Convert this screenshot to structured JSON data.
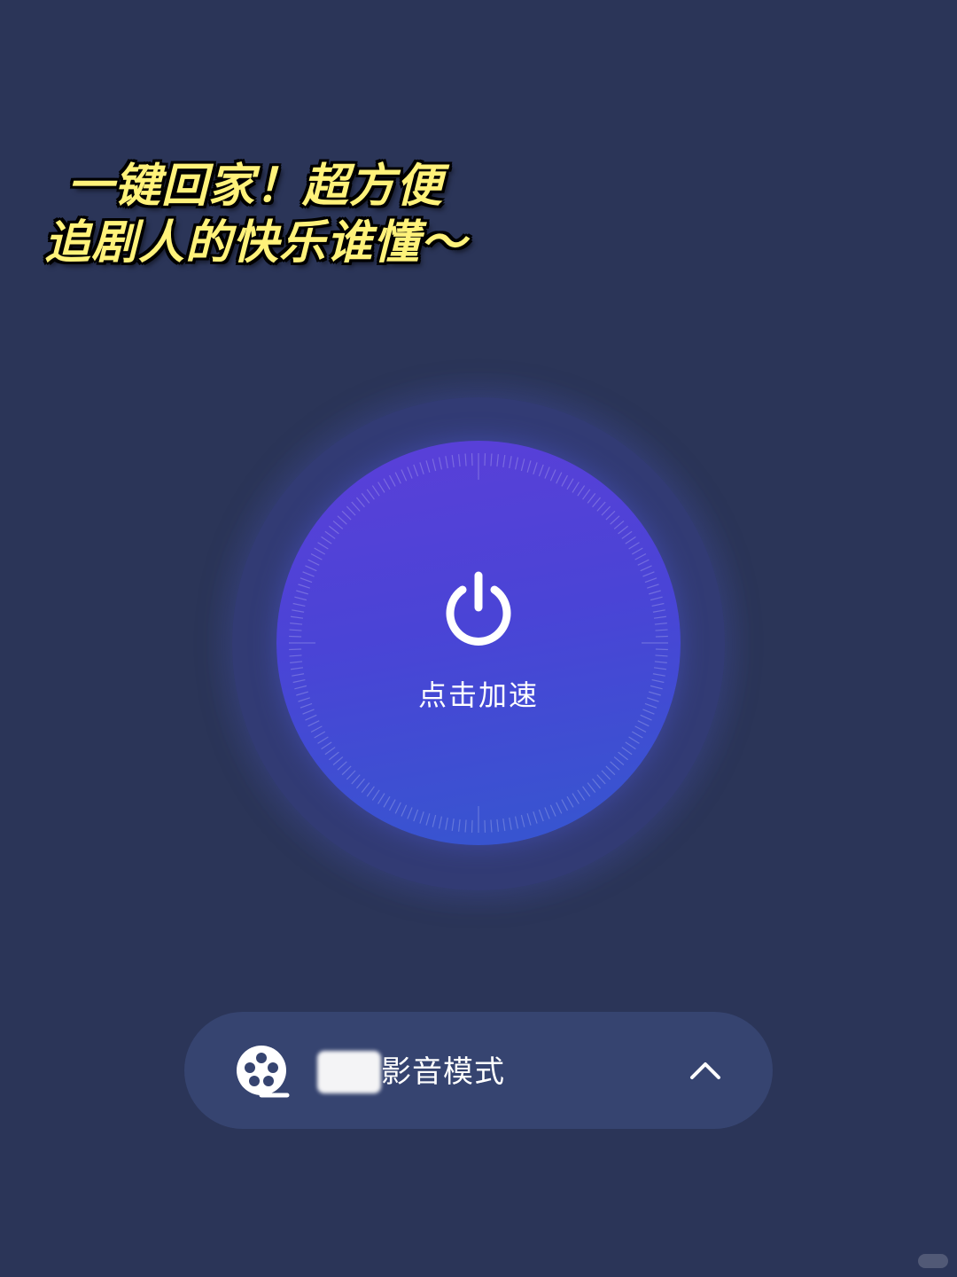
{
  "headline": {
    "line1": "一键回家！超方便",
    "line2": "追剧人的快乐谁懂～"
  },
  "accelerate": {
    "label": "点击加速",
    "icon": "power-icon"
  },
  "mode_selector": {
    "label": "影音模式",
    "icon": "film-reel-icon",
    "expand_icon": "chevron-up-icon"
  },
  "colors": {
    "background": "#2b3558",
    "button_top": "#5b3fd8",
    "button_bottom": "#3557cf",
    "headline_text": "#fff27a",
    "mode_bar": "#364470"
  }
}
